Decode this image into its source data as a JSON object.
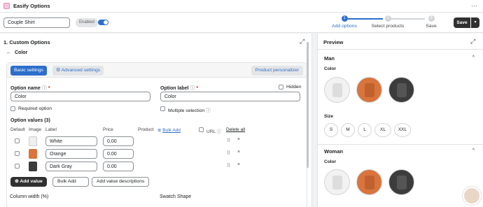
{
  "app": {
    "title": "Easify Options"
  },
  "toolbar": {
    "option_set_name": "Couple Shirt",
    "enabled_label": "Enabled",
    "steps": [
      {
        "num": "1",
        "label": "Add options"
      },
      {
        "num": "2",
        "label": "Select products"
      },
      {
        "num": "3",
        "label": "Save"
      }
    ],
    "save_label": "Save"
  },
  "editor": {
    "section_title": "1. Custom Options",
    "back_label": "Color",
    "tabs": {
      "basic": "Basic settings",
      "advanced": "Advanced settings",
      "personalizer": "Product personalizer"
    },
    "option_name_label": "Option name",
    "option_name_value": "Color",
    "option_label_label": "Option label",
    "option_label_value": "Color",
    "hidden_label": "Hidden",
    "required_label": "Required option",
    "multiple_label": "Multiple selection",
    "values_title": "Option values (3)",
    "columns": {
      "default": "Default",
      "image": "Image",
      "label": "Label",
      "price": "Price",
      "product": "Product",
      "bulk_add": "Bulk Add",
      "url": "URL",
      "delete_all": "Delete all"
    },
    "rows": [
      {
        "label": "White",
        "price": "0.00"
      },
      {
        "label": "Orange",
        "price": "0.00"
      },
      {
        "label": "Dark Gray",
        "price": "0.00"
      }
    ],
    "buttons": {
      "add_value": "Add value",
      "bulk_add": "Bulk Add",
      "add_descriptions": "Add value descriptions"
    },
    "column_width_label": "Column width (%)",
    "swatch_shape_label": "Swatch Shape"
  },
  "preview": {
    "title": "Preview",
    "groups": [
      {
        "name": "Man",
        "color_label": "Color",
        "size_label": "Size",
        "sizes": [
          "S",
          "M",
          "L",
          "XL",
          "XXL"
        ]
      },
      {
        "name": "Woman",
        "color_label": "Color"
      }
    ],
    "colors": {
      "white": "#f2f2f2",
      "orange": "#d9743c",
      "dark_gray": "#3c3c3c"
    }
  },
  "colors": {
    "accent": "#2c6ecb",
    "dark_button": "#303030"
  }
}
